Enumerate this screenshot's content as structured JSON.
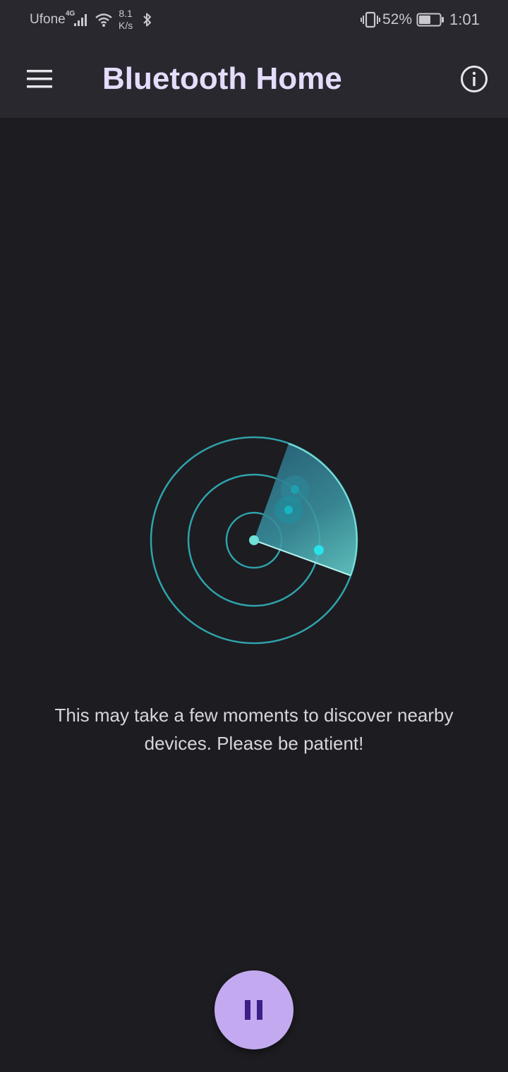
{
  "status_bar": {
    "carrier": "Ufone",
    "network_type": "4G",
    "data_speed_value": "8.1",
    "data_speed_unit": "K/s",
    "battery_percent": "52%",
    "time": "1:01",
    "icons": [
      "signal-icon",
      "wifi-icon",
      "bluetooth-icon",
      "vibrate-icon",
      "battery-icon"
    ]
  },
  "app_bar": {
    "title": "Bluetooth Home",
    "menu_icon": "hamburger-menu-icon",
    "info_icon": "info-icon"
  },
  "scanner": {
    "message": "This may take a few moments to discover nearby devices. Please be patient!",
    "accent_color": "#2fa3ab",
    "sweep_color": "#55c9c8"
  },
  "fab": {
    "icon": "pause-icon",
    "color": "#c3aaf0",
    "icon_color": "#3a1f88"
  }
}
